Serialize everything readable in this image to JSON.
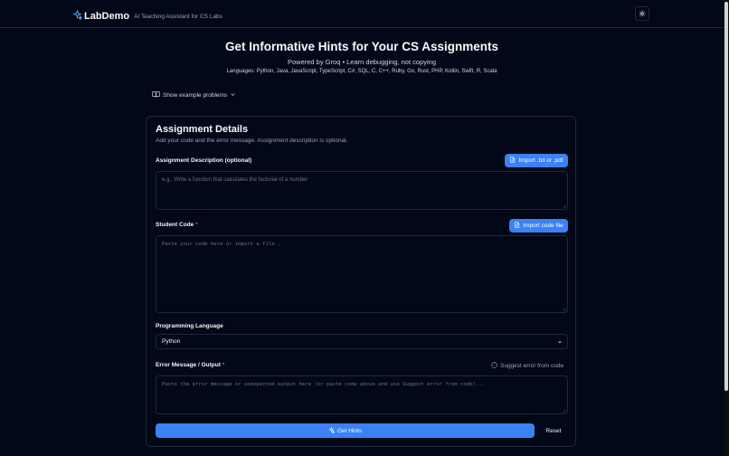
{
  "header": {
    "brand": "LabDemo",
    "tagline": "AI Teaching Assistant for CS Labs"
  },
  "hero": {
    "title": "Get Informative Hints for Your CS Assignments",
    "subtitle": "Powered by Groq • Learn debugging, not copying",
    "languages": "Languages: Python, Java, JavaScript, TypeScript, C#, SQL, C, C++, Ruby, Go, Rust, PHP, Kotlin, Swift, R, Scala"
  },
  "examples_toggle": "Show example problems",
  "card": {
    "title": "Assignment Details",
    "description": "Add your code and the error message. Assignment description is optional."
  },
  "assignment": {
    "label": "Assignment Description (optional)",
    "import_label": "Import .txt or .pdf",
    "placeholder": "e.g., Write a function that calculates the factorial of a number"
  },
  "code": {
    "label": "Student Code",
    "required_mark": "*",
    "import_label": "Import code file",
    "placeholder": "Paste your code here or import a file..."
  },
  "language": {
    "label": "Programming Language",
    "selected": "Python"
  },
  "error": {
    "label": "Error Message / Output",
    "required_mark": "*",
    "suggest_label": "Suggest error from code",
    "placeholder": "Paste the error message or unexpected output here (or paste code above and use Suggest error from code)..."
  },
  "actions": {
    "get_hints": "Get Hints",
    "reset": "Reset"
  },
  "colors": {
    "background": "#020817",
    "accent": "#3b82f6",
    "border": "#1e293b",
    "required": "#ef4444"
  }
}
